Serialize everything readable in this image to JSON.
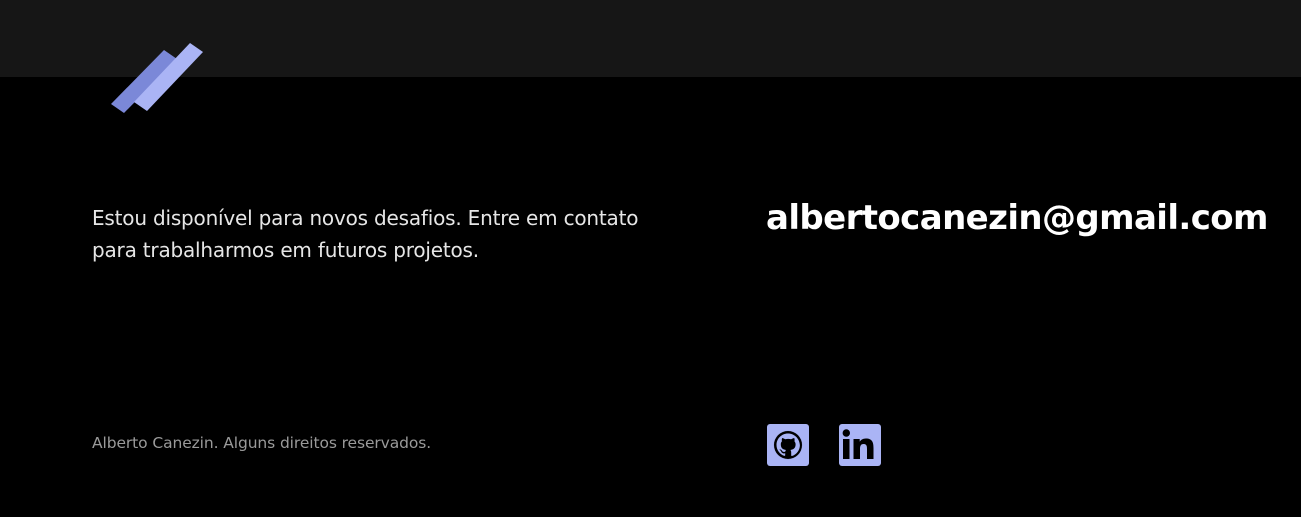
{
  "logo": {
    "icon": "double-slash-logo",
    "colors": [
      "#7b88d8",
      "#aab4f5"
    ]
  },
  "contact": {
    "tagline": "Estou disponível para novos desafios. Entre em contato para trabalharmos em futuros projetos.",
    "email": "albertocanezin@gmail.com"
  },
  "footer": {
    "copyright": "Alberto Canezin. Alguns direitos reservados."
  },
  "socials": [
    {
      "name": "GitHub",
      "icon": "github-icon"
    },
    {
      "name": "LinkedIn",
      "icon": "linkedin-icon"
    }
  ],
  "colors": {
    "header_band": "#161616",
    "background": "#000000",
    "accent": "#aab4f5"
  }
}
